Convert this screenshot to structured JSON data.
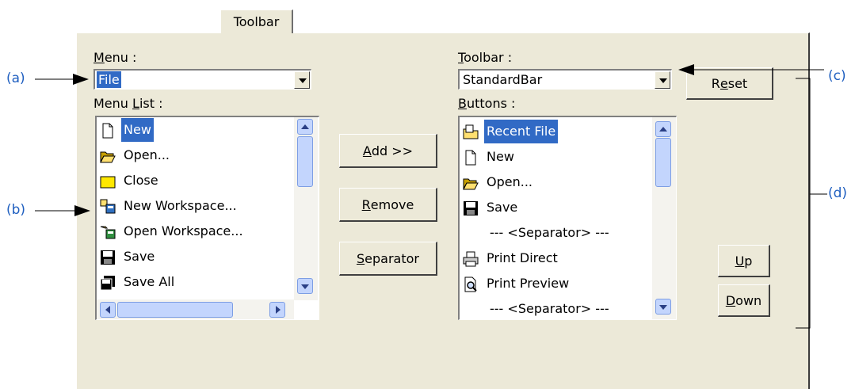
{
  "tab": {
    "label": "Toolbar"
  },
  "menu": {
    "label_u": "M",
    "label_rest": "enu :",
    "value": "File",
    "list_label_pre": "Menu ",
    "list_label_u": "L",
    "list_label_rest": "ist :",
    "items": [
      {
        "label": "New",
        "icon": "new-document-icon",
        "selected": true
      },
      {
        "label": "Open...",
        "icon": "open-folder-icon"
      },
      {
        "label": "Close",
        "icon": "folder-icon"
      },
      {
        "label": "New Workspace...",
        "icon": "new-workspace-icon"
      },
      {
        "label": "Open Workspace...",
        "icon": "open-workspace-icon"
      },
      {
        "label": "Save",
        "icon": "save-disk-icon"
      },
      {
        "label": "Save All",
        "icon": "save-all-icon"
      }
    ]
  },
  "toolbar": {
    "label_u": "T",
    "label_rest": "oolbar :",
    "value": "StandardBar",
    "reset_pre": "R",
    "reset_u": "e",
    "reset_rest": "set",
    "buttons_label_u": "B",
    "buttons_label_rest": "uttons :",
    "items": [
      {
        "label": "Recent File",
        "icon": "recent-file-icon",
        "selected": true
      },
      {
        "label": "New",
        "icon": "new-document-icon"
      },
      {
        "label": "Open...",
        "icon": "open-folder-icon"
      },
      {
        "label": "Save",
        "icon": "save-disk-icon"
      },
      {
        "label": "--- <Separator> ---",
        "icon": ""
      },
      {
        "label": "Print Direct",
        "icon": "printer-icon"
      },
      {
        "label": "Print Preview",
        "icon": "print-preview-icon"
      },
      {
        "label": "--- <Separator> ---",
        "icon": ""
      }
    ]
  },
  "actions": {
    "add_u": "A",
    "add_rest": "dd >>",
    "remove_u": "R",
    "remove_rest": "emove",
    "separator_u": "S",
    "separator_rest": "eparator",
    "up_u": "U",
    "up_rest": "p",
    "down_u": "D",
    "down_rest": "own"
  },
  "annotations": {
    "a": "(a)",
    "b": "(b)",
    "c": "(c)",
    "d": "(d)"
  },
  "colors": {
    "panel": "#ece9d8",
    "selection": "#316ac5",
    "annotation": "#1f5fc0"
  }
}
